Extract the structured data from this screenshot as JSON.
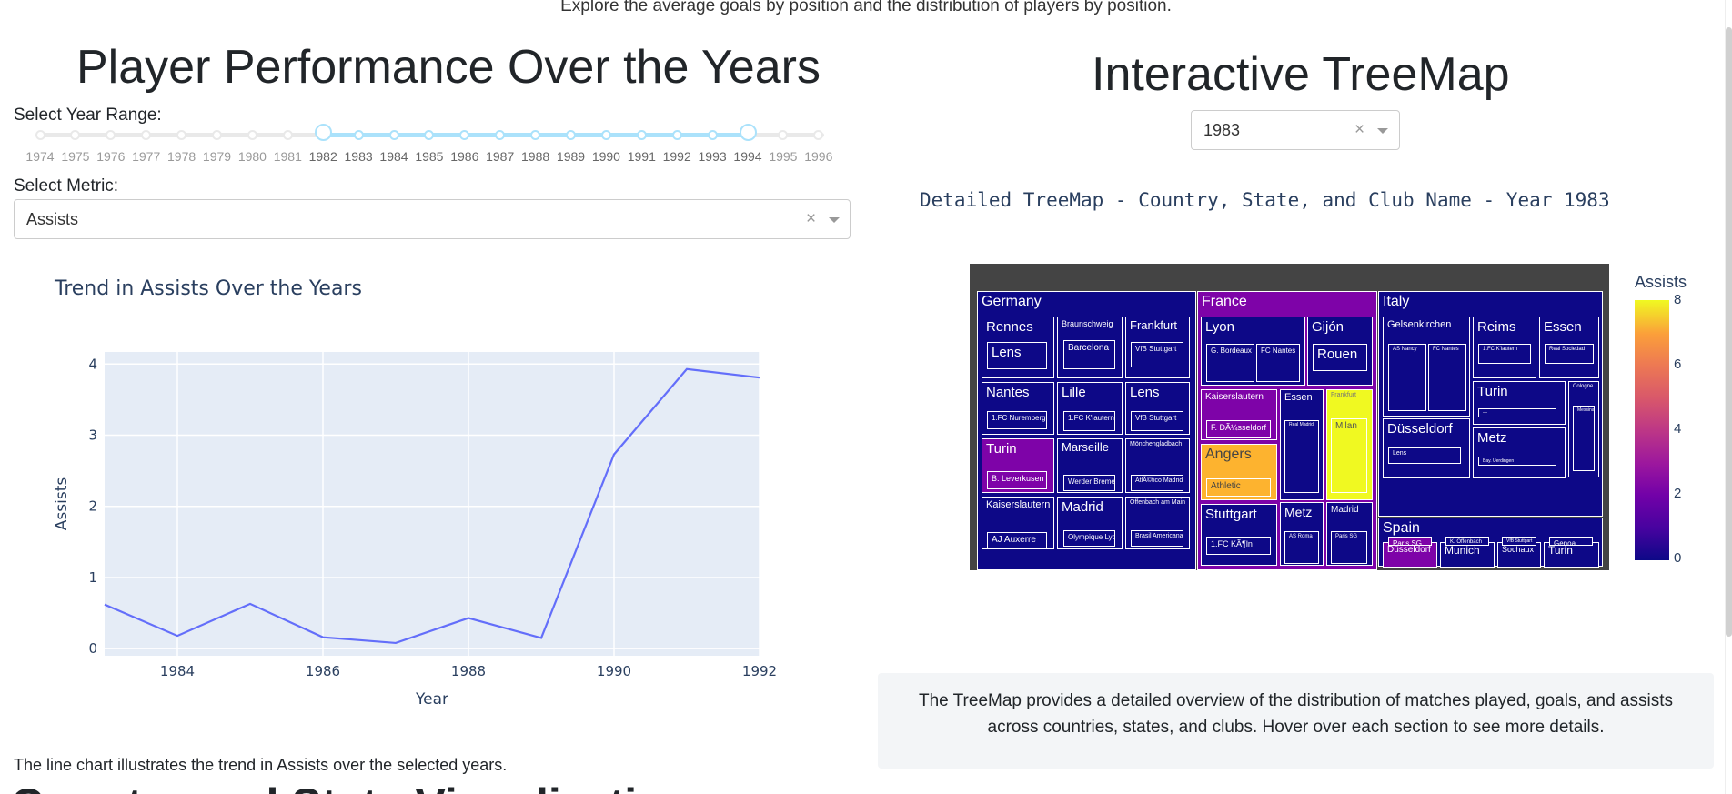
{
  "page": {
    "description": "Explore the average goals by position and the distribution of players by position.",
    "next_section_heading": "Country and State Visualization"
  },
  "left": {
    "title": "Player Performance Over the Years",
    "year_range_label": "Select Year Range:",
    "year_marks": [
      "1974",
      "1975",
      "1976",
      "1977",
      "1978",
      "1979",
      "1980",
      "1981",
      "1982",
      "1983",
      "1984",
      "1985",
      "1986",
      "1987",
      "1988",
      "1989",
      "1990",
      "1991",
      "1992",
      "1993",
      "1994",
      "1995",
      "1996"
    ],
    "year_range_selected": [
      "1982",
      "1994"
    ],
    "metric_label": "Select Metric:",
    "metric_value": "Assists",
    "caption": "The line chart illustrates the trend in Assists over the selected years."
  },
  "chart_data": {
    "type": "line",
    "title": "Trend in Assists Over the Years",
    "xlabel": "Year",
    "ylabel": "Assists",
    "x": [
      1983,
      1984,
      1985,
      1986,
      1987,
      1988,
      1989,
      1990,
      1991,
      1992
    ],
    "series": [
      {
        "values": [
          0.62,
          0.18,
          0.63,
          0.16,
          0.08,
          0.43,
          0.15,
          2.73,
          3.93,
          3.81
        ]
      }
    ],
    "xlim": [
      1983,
      1992
    ],
    "ylim": [
      -0.1,
      4.17
    ],
    "xticks": [
      "1984",
      "1986",
      "1988",
      "1990",
      "1992"
    ],
    "yticks": [
      "0",
      "1",
      "2",
      "3",
      "4"
    ],
    "grid": true,
    "line_color": "#636efa",
    "plot_bg": "#e5ecf6"
  },
  "right": {
    "title": "Interactive TreeMap",
    "year_select_value": "1983",
    "treemap_title": "Detailed TreeMap - Country, State, and Club Name - Year 1983",
    "colorbar_title": "Assists",
    "colorbar_ticks": [
      "8",
      "6",
      "4",
      "2",
      "0"
    ],
    "info_text": "The TreeMap provides a detailed overview of the distribution of matches played, goals, and assists across countries, states, and clubs. Hover over each section to see more details."
  },
  "treemap_labels": {
    "germany": "Germany",
    "france": "France",
    "italy": "Italy",
    "spain": "Spain",
    "de_rennes": "Rennes",
    "de_lens": "Lens",
    "de_braunschweig": "Braunschweig",
    "de_barcelona": "Barcelona",
    "de_frankfurt": "Frankfurt",
    "de_vfb1": "VfB Stuttgart",
    "de_nantes": "Nantes",
    "de_nuremberg": "1.FC Nuremberg",
    "de_lille": "Lille",
    "de_kl1": "1.FC K'lautern",
    "de_lens2": "Lens",
    "de_vfb2": "VfB Stuttgart",
    "de_turin": "Turin",
    "de_leverkusen": "B. Leverkusen",
    "de_marseille": "Marseille",
    "de_werder": "Werder Bremen",
    "de_mgladbach": "Mönchengladbach",
    "de_atletico": "AtlÃ©tico Madrid",
    "de_kaiserslautern": "Kaiserslautern",
    "de_auxerre": "AJ Auxerre",
    "de_madrid": "Madrid",
    "de_lyon": "Olympique Lyon",
    "de_offenbach": "Offenbach am Main",
    "de_brasil": "Brasil Americana",
    "fr_lyon": "Lyon",
    "fr_bordeaux": "G. Bordeaux",
    "fr_nantes": "FC Nantes",
    "fr_gijon": "Gijón",
    "fr_rouen": "Rouen",
    "fr_kaiserslautern": "Kaiserslautern",
    "fr_dusseldorf": "F. DÃ¼sseldorf",
    "fr_essen": "Essen",
    "fr_realmadrid": "Real Madrid",
    "fr_frankfurt": "Frankfurt",
    "fr_milan": "Milan",
    "fr_angers": "Angers",
    "fr_athletic": "Athletic",
    "fr_metz": "Metz",
    "fr_asroma": "AS Roma",
    "fr_madrid": "Madrid",
    "fr_psg": "Paris SG",
    "fr_stuttgart": "Stuttgart",
    "fr_koln": "1.FC KÃ¶ln",
    "it_gelsenkirchen": "Gelsenkirchen",
    "it_nancy": "AS Nancy",
    "it_nantes": "FC Nantes",
    "it_reims": "Reims",
    "it_kl": "1.FC K'lautern",
    "it_essen": "Essen",
    "it_sociedad": "Real Sociedad",
    "it_turin": "Turin",
    "it_turin_club": "—",
    "it_cologne": "Cologne",
    "it_messina": "Messina",
    "it_dusseldorf": "Düsseldorf",
    "it_lens": "Lens",
    "it_metz": "Metz",
    "it_uerdingen": "Bay. Uerdingen",
    "es_dusseldorf": "Düsseldorf",
    "es_psg": "Paris SG",
    "es_munich": "Munich",
    "es_offenbach": "K. Offenbach",
    "es_sochaux": "Sochaux",
    "es_vfb": "VfB Stuttgart",
    "es_turin": "Turin",
    "es_genoa": "Genoa"
  },
  "colors": {
    "plasma_low": "#0d0887",
    "plasma_mid": "#7e03a8",
    "plasma_high": "#f0f921",
    "angers": "#fdb32f",
    "line": "#636efa"
  }
}
